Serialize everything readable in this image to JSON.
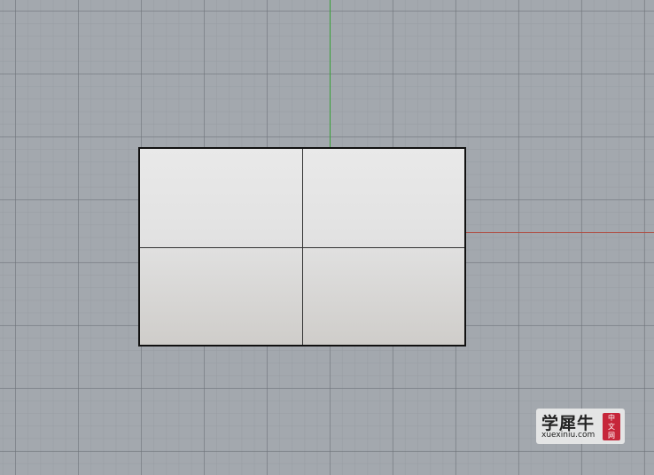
{
  "viewport": {
    "background_color": "#a3a8ae",
    "grid_major_color": "#6e737a",
    "grid_minor_color": "#969ba1",
    "y_axis_color": "#3aa13a",
    "x_axis_color": "#b04a3e"
  },
  "surface": {
    "border_color": "#111111",
    "fill_top": "#e9e9e9",
    "fill_bottom": "#cfcdca"
  },
  "watermark": {
    "logo_text": "学犀牛",
    "url": "xuexiniu.com",
    "stamp_chars": [
      "中",
      "文",
      "网"
    ],
    "stamp_color": "#c6263a"
  }
}
